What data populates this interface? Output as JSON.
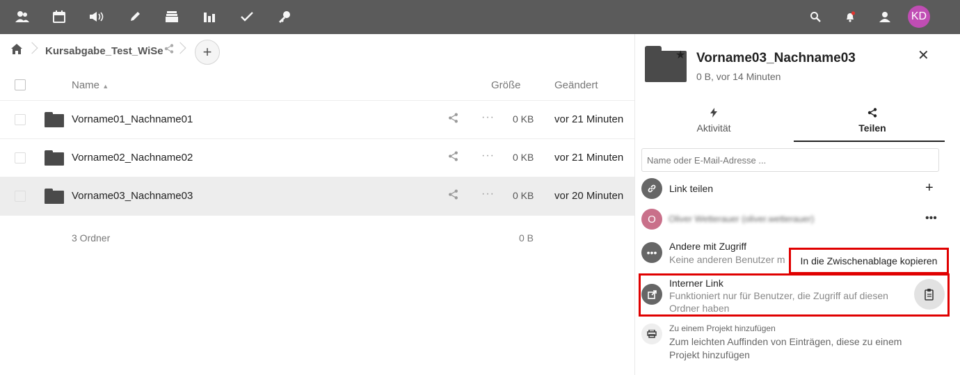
{
  "topbar": {
    "nav_icons": [
      "contacts-icon",
      "calendar-icon",
      "announcements-icon",
      "pencil-icon",
      "archive-icon",
      "chart-icon",
      "check-icon",
      "key-icon"
    ],
    "right_icons": [
      "search-icon",
      "bell-icon",
      "contacts-menu-icon"
    ],
    "avatar_initials": "KD",
    "avatar_color": "#c04db4"
  },
  "breadcrumb": {
    "current": "Kursabgabe_Test_WiSe"
  },
  "table": {
    "header": {
      "name": "Name",
      "size": "Größe",
      "modified": "Geändert"
    },
    "rows": [
      {
        "name": "Vorname01_Nachname01",
        "size": "0 KB",
        "modified": "vor 21 Minuten",
        "more": "···"
      },
      {
        "name": "Vorname02_Nachname02",
        "size": "0 KB",
        "modified": "vor 21 Minuten",
        "more": "···"
      },
      {
        "name": "Vorname03_Nachname03",
        "size": "0 KB",
        "modified": "vor 20 Minuten",
        "more": "···"
      }
    ],
    "summary": {
      "label": "3 Ordner",
      "size": "0 B"
    }
  },
  "sidebar": {
    "title": "Vorname03_Nachname03",
    "subtitle": "0 B, vor 14 Minuten",
    "tabs": {
      "activity": "Aktivität",
      "share": "Teilen"
    },
    "share_input_placeholder": "Name oder E-Mail-Adresse ...",
    "link_share": "Link teilen",
    "sharee": {
      "initial": "O",
      "name": "Oliver Wetterauer (oliver.wetterauer)",
      "color": "#c9708a"
    },
    "others": {
      "title": "Andere mit Zugriff",
      "subtitle": "Keine anderen Benutzer m"
    },
    "tooltip": "In die Zwischenablage kopieren",
    "internal_link": {
      "title": "Interner Link",
      "desc_line1": "Funktioniert nur für Benutzer, die Zugriff auf diesen",
      "desc_line2": "Ordner haben"
    },
    "project": {
      "title": "Zu einem Projekt hinzufügen",
      "desc_line1": "Zum leichten Auffinden von Einträgen, diese zu einem",
      "desc_line2": "Projekt hinzufügen"
    }
  },
  "colors": {
    "topbar": "#5b5b5b",
    "highlight": "#e00000"
  }
}
